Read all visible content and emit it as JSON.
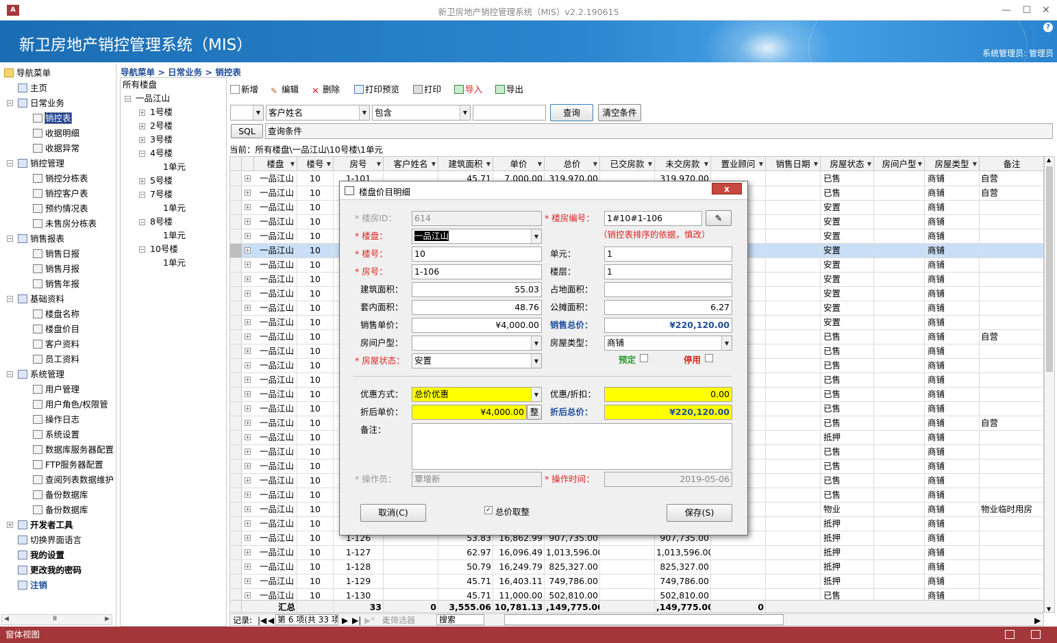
{
  "window": {
    "title": "新卫房地产销控管理系统（MIS）v2.2.190615"
  },
  "banner": {
    "title": "新卫房地产销控管理系统（MIS）",
    "user": "系统管理员: 管理员"
  },
  "nav": {
    "root": "导航菜单",
    "items": [
      {
        "label": "主页",
        "level": 1
      },
      {
        "label": "日常业务",
        "level": 1,
        "toggle": "−"
      },
      {
        "label": "销控表",
        "level": 2,
        "selected": true
      },
      {
        "label": "收据明细",
        "level": 2
      },
      {
        "label": "收据异常",
        "level": 2
      },
      {
        "label": "销控管理",
        "level": 1,
        "toggle": "−"
      },
      {
        "label": "销控分栋表",
        "level": 2
      },
      {
        "label": "销控客户表",
        "level": 2
      },
      {
        "label": "预约情况表",
        "level": 2
      },
      {
        "label": "未售房分栋表",
        "level": 2
      },
      {
        "label": "销售报表",
        "level": 1,
        "toggle": "−"
      },
      {
        "label": "销售日报",
        "level": 2
      },
      {
        "label": "销售月报",
        "level": 2
      },
      {
        "label": "销售年报",
        "level": 2
      },
      {
        "label": "基础资料",
        "level": 1,
        "toggle": "−"
      },
      {
        "label": "楼盘名称",
        "level": 2
      },
      {
        "label": "楼盘价目",
        "level": 2
      },
      {
        "label": "客户资料",
        "level": 2
      },
      {
        "label": "员工资料",
        "level": 2
      },
      {
        "label": "系统管理",
        "level": 1,
        "toggle": "−"
      },
      {
        "label": "用户管理",
        "level": 2
      },
      {
        "label": "用户角色/权限管",
        "level": 2
      },
      {
        "label": "操作日志",
        "level": 2
      },
      {
        "label": "系统设置",
        "level": 2
      },
      {
        "label": "数据库服务器配置",
        "level": 2
      },
      {
        "label": "FTP服务器配置",
        "level": 2
      },
      {
        "label": "查阅列表数据维护",
        "level": 2
      },
      {
        "label": "备份数据库",
        "level": 2
      },
      {
        "label": "备份数据库",
        "level": 2
      },
      {
        "label": "开发者工具",
        "level": 1,
        "toggle": "+",
        "bold": true
      },
      {
        "label": "切换界面语言",
        "level": 1
      },
      {
        "label": "我的设置",
        "level": 1,
        "bold": true
      },
      {
        "label": "更改我的密码",
        "level": 1,
        "bold": true
      },
      {
        "label": "注销",
        "level": 1,
        "bold": true,
        "blue": true
      }
    ]
  },
  "breadcrumb": "导航菜单 > 日常业务 > 销控表",
  "tree": {
    "root": "所有楼盘",
    "nodes": [
      {
        "label": "一品江山",
        "indent": 0,
        "toggle": "−"
      },
      {
        "label": "1号楼",
        "indent": 1,
        "toggle": "+"
      },
      {
        "label": "2号楼",
        "indent": 1,
        "toggle": "+"
      },
      {
        "label": "3号楼",
        "indent": 1,
        "toggle": "+"
      },
      {
        "label": "4号楼",
        "indent": 1,
        "toggle": "−"
      },
      {
        "label": "1单元",
        "indent": 2
      },
      {
        "label": "5号楼",
        "indent": 1,
        "toggle": "+"
      },
      {
        "label": "7号楼",
        "indent": 1,
        "toggle": "−"
      },
      {
        "label": "1单元",
        "indent": 2
      },
      {
        "label": "8号楼",
        "indent": 1,
        "toggle": "−"
      },
      {
        "label": "1单元",
        "indent": 2
      },
      {
        "label": "10号楼",
        "indent": 1,
        "toggle": "−"
      },
      {
        "label": "1单元",
        "indent": 2
      }
    ]
  },
  "toolbar": {
    "new": "新增",
    "edit": "编辑",
    "delete": "删除",
    "preview": "打印预览",
    "print": "打印",
    "import": "导入",
    "export": "导出"
  },
  "filter": {
    "field": "客户姓名",
    "op": "包含",
    "value": "",
    "query": "查询",
    "clear": "清空条件",
    "sql": "SQL",
    "cond": "查询条件"
  },
  "current": "当前：所有楼盘\\一品江山\\10号楼\\1单元",
  "grid": {
    "columns": [
      "楼盘",
      "楼号",
      "房号",
      "客户姓名",
      "建筑面积",
      "单价",
      "总价",
      "已交房款",
      "未交房款",
      "置业顾问",
      "销售日期",
      "房屋状态",
      "房间户型",
      "房屋类型",
      "备注"
    ],
    "rows": [
      {
        "p": "一品江山",
        "b": "10",
        "r": "1-101",
        "area": "45.71",
        "price": "7,000.00",
        "total": "319,970.00",
        "unpaid": "319,970.00",
        "st": "已售",
        "tp": "商铺",
        "note": "自营"
      },
      {
        "p": "一品江山",
        "b": "10",
        "r": "1-102",
        "area": "",
        "price": "",
        "total": "",
        "unpaid": "",
        "st": "已售",
        "tp": "商铺",
        "note": "自营"
      },
      {
        "p": "一品江山",
        "b": "10",
        "st": "安置",
        "tp": "商铺"
      },
      {
        "p": "一品江山",
        "b": "10",
        "st": "安置",
        "tp": "商铺"
      },
      {
        "p": "一品江山",
        "b": "10",
        "st": "安置",
        "tp": "商铺"
      },
      {
        "p": "一品江山",
        "b": "10",
        "st": "安置",
        "tp": "商铺",
        "hl": true
      },
      {
        "p": "一品江山",
        "b": "10",
        "st": "安置",
        "tp": "商铺"
      },
      {
        "p": "一品江山",
        "b": "10",
        "st": "安置",
        "tp": "商铺"
      },
      {
        "p": "一品江山",
        "b": "10",
        "st": "安置",
        "tp": "商铺"
      },
      {
        "p": "一品江山",
        "b": "10",
        "st": "安置",
        "tp": "商铺"
      },
      {
        "p": "一品江山",
        "b": "10",
        "st": "安置",
        "tp": "商铺"
      },
      {
        "p": "一品江山",
        "b": "10",
        "st": "已售",
        "tp": "商铺",
        "note": "自营"
      },
      {
        "p": "一品江山",
        "b": "10",
        "st": "已售",
        "tp": "商铺"
      },
      {
        "p": "一品江山",
        "b": "10",
        "st": "已售",
        "tp": "商铺"
      },
      {
        "p": "一品江山",
        "b": "10",
        "st": "已售",
        "tp": "商铺"
      },
      {
        "p": "一品江山",
        "b": "10",
        "st": "已售",
        "tp": "商铺"
      },
      {
        "p": "一品江山",
        "b": "10",
        "st": "已售",
        "tp": "商铺"
      },
      {
        "p": "一品江山",
        "b": "10",
        "st": "已售",
        "tp": "商铺",
        "note": "自营"
      },
      {
        "p": "一品江山",
        "b": "10",
        "st": "抵押",
        "tp": "商铺"
      },
      {
        "p": "一品江山",
        "b": "10",
        "st": "已售",
        "tp": "商铺"
      },
      {
        "p": "一品江山",
        "b": "10",
        "st": "已售",
        "tp": "商铺"
      },
      {
        "p": "一品江山",
        "b": "10",
        "st": "已售",
        "tp": "商铺"
      },
      {
        "p": "一品江山",
        "b": "10",
        "st": "已售",
        "tp": "商铺"
      },
      {
        "p": "一品江山",
        "b": "10",
        "st": "物业",
        "tp": "商铺",
        "note": "物业临时用房"
      },
      {
        "p": "一品江山",
        "b": "10",
        "st": "抵押",
        "tp": "商铺"
      },
      {
        "p": "一品江山",
        "b": "10",
        "r": "1-126",
        "area": "53.83",
        "price": "16,862.99",
        "total": "907,735.00",
        "unpaid": "907,735.00",
        "st": "抵押",
        "tp": "商铺"
      },
      {
        "p": "一品江山",
        "b": "10",
        "r": "1-127",
        "area": "62.97",
        "price": "16,096.49",
        "total": "1,013,596.00",
        "unpaid": "1,013,596.00",
        "st": "抵押",
        "tp": "商铺"
      },
      {
        "p": "一品江山",
        "b": "10",
        "r": "1-128",
        "area": "50.79",
        "price": "16,249.79",
        "total": "825,327.00",
        "unpaid": "825,327.00",
        "st": "抵押",
        "tp": "商铺"
      },
      {
        "p": "一品江山",
        "b": "10",
        "r": "1-129",
        "area": "45.71",
        "price": "16,403.11",
        "total": "749,786.00",
        "unpaid": "749,786.00",
        "st": "抵押",
        "tp": "商铺"
      },
      {
        "p": "一品江山",
        "b": "10",
        "r": "1-130",
        "area": "45.71",
        "price": "11,000.00",
        "total": "502,810.00",
        "unpaid": "502,810.00",
        "st": "已售",
        "tp": "商铺"
      }
    ],
    "summary": {
      "label": "汇总",
      "b": "33",
      "cust": "0",
      "area": "3,555.06",
      "price": "10,781.13",
      "total": ",149,775.00",
      "unpaid": ",149,775.00",
      "adv": "0"
    }
  },
  "recnav": {
    "label": "记录:",
    "pos": "第 6 项(共 33 项",
    "nofilter": "无筛选器",
    "search": "搜索"
  },
  "status": "窗体视图",
  "dialog": {
    "title": "楼盘价目明细",
    "close": "x",
    "house_id_label": "* 楼房ID：",
    "house_id": "614",
    "house_no_label": "* 楼房编号：",
    "house_no": "1#10#1-106",
    "project_label": "* 楼盘：",
    "project": "一品江山",
    "hint": "（销控表排序的依据，慎改）",
    "building_label": "* 楼号：",
    "building": "10",
    "unit_label": "单元：",
    "unit": "1",
    "room_label": "* 房号：",
    "room": "1-106",
    "floor_label": "楼层：",
    "floor": "1",
    "area_label": "建筑面积：",
    "area": "55.03",
    "land_label": "占地面积：",
    "land": "",
    "inner_label": "套内面积：",
    "inner": "48.76",
    "shared_label": "公摊面积：",
    "shared": "6.27",
    "price_label": "销售单价：",
    "price": "¥4,000.00",
    "total_label": "销售总价：",
    "total": "¥220,120.00",
    "layout_label": "房间户型：",
    "layout": "",
    "type_label": "房屋类型：",
    "type": "商铺",
    "state_label": "* 房屋状态：",
    "state": "安置",
    "reserved_label": "预定",
    "disabled_label": "停用",
    "discount_mode_label": "优惠方式：",
    "discount_mode": "总价优惠",
    "discount_label": "优惠/折扣：",
    "discount": "0.00",
    "disc_price_label": "折后单价：",
    "disc_price": "¥4,000.00",
    "round_btn": "整",
    "disc_total_label": "折后总价：",
    "disc_total": "¥220,120.00",
    "note_label": "备注：",
    "operator_label": "* 操作员：",
    "operator": "覃增新",
    "optime_label": "* 操作时间：",
    "optime": "2019-05-06",
    "cancel": "取消(C)",
    "round_total": "总价取整",
    "save": "保存(S)"
  }
}
